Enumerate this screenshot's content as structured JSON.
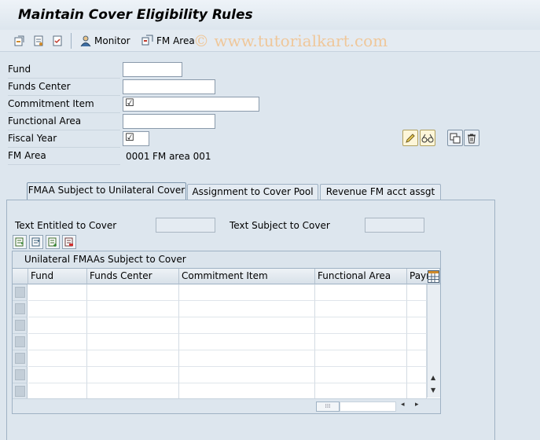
{
  "window": {
    "title": "Maintain Cover Eligibility Rules"
  },
  "toolbar": {
    "icons": [
      "display-change-icon",
      "other-rule-icon",
      "check-icon"
    ],
    "monitor_label": "Monitor",
    "fm_area_label": "FM Area",
    "watermark": "© www.tutorialkart.com"
  },
  "form": {
    "fund_label": "Fund",
    "fund_value": "",
    "funds_center_label": "Funds Center",
    "funds_center_value": "",
    "commitment_item_label": "Commitment Item",
    "commitment_item_value": "☑",
    "functional_area_label": "Functional Area",
    "functional_area_value": "",
    "fiscal_year_label": "Fiscal Year",
    "fiscal_year_value": "☑",
    "fm_area_label": "FM Area",
    "fm_area_code": "0001",
    "fm_area_text": "FM area 001"
  },
  "action_icons": [
    "pencil-icon",
    "glasses-icon",
    "copy-icon",
    "delete-icon"
  ],
  "tabs": [
    {
      "label": "FMAA Subject to Unilateral Cover",
      "active": true
    },
    {
      "label": "Assignment to Cover Pool",
      "active": false
    },
    {
      "label": "Revenue FM acct assgt",
      "active": false
    }
  ],
  "panel": {
    "text_entitled_label": "Text Entitled to Cover",
    "text_entitled_value": "",
    "text_subject_label": "Text Subject to Cover",
    "text_subject_value": ""
  },
  "grid": {
    "title": "Unilateral FMAAs Subject to Cover",
    "columns": [
      "Fund",
      "Funds Center",
      "Commitment Item",
      "Functional Area",
      "Payr"
    ],
    "rows": [
      [
        "",
        "",
        "",
        "",
        ""
      ],
      [
        "",
        "",
        "",
        "",
        ""
      ],
      [
        "",
        "",
        "",
        "",
        ""
      ],
      [
        "",
        "",
        "",
        "",
        ""
      ],
      [
        "",
        "",
        "",
        "",
        ""
      ],
      [
        "",
        "",
        "",
        "",
        ""
      ],
      [
        "",
        "",
        "",
        "",
        ""
      ]
    ]
  }
}
